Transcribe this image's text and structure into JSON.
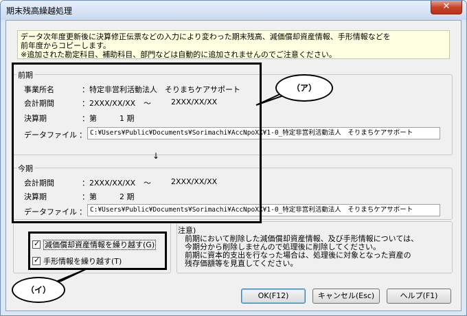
{
  "window": {
    "title": "期末残高繰越処理",
    "close_glyph": "✕"
  },
  "notice": {
    "line1": "データ次年度更新後に決算修正伝票などの入力により変わった期末残高、減価償却資産情報、手形情報などを",
    "line2": "前年度からコピーします。",
    "line3": "※追加された勘定科目、補助科目、部門などは自動的に追加されませんのでご注意ください。"
  },
  "previous": {
    "legend": "前期",
    "office_label": "事業所名",
    "office_value": "：特定非営利活動法人　そりまちケアサポート",
    "period_label": "会計期間",
    "period_from": "：2XXX/XX/XX",
    "period_sep": "～",
    "period_to": "2XXX/XX/XX",
    "term_label": "決算期",
    "term_value": "：第　　　1 期",
    "datafile_label": "データファイル",
    "datafile_colon": "：",
    "datafile_value": "C:¥Users¥Public¥Documents¥Sorimachi¥AccNpoXX¥1-0_特定非営利活動法人　そりまちケアサポート"
  },
  "arrow": "↓",
  "current": {
    "legend": "今期",
    "period_label": "会計期間",
    "period_from": "：2XXX/XX/XX",
    "period_sep": "～",
    "period_to": "2XXX/XX/XX",
    "term_label": "決算期",
    "term_value": "：第　　　2 期",
    "datafile_label": "データファイル",
    "datafile_colon": "：",
    "datafile_value": "C:¥Users¥Public¥Documents¥Sorimachi¥AccNpoXX¥1-0_特定非営利活動法人　そりまちケアサポート"
  },
  "options": {
    "depreciation_label": "減価償却資産情報を繰り越す(G)",
    "depreciation_checked": true,
    "notes_label": "手形情報を繰り越す(T)",
    "notes_checked": true
  },
  "caution": {
    "title": "注意)",
    "line1": "前期において削除した減価償却資産情報、及び手形情報については、",
    "line2": "今期分から削除しませんので処理後に削除してください。",
    "line3": "前期に資本的支出を行なった場合は、処理後に対象となった資産の",
    "line4": "残存価額等を見直してください。"
  },
  "callouts": {
    "a": "（ア）",
    "b": "（イ）"
  },
  "buttons": {
    "ok": "OK(F12)",
    "cancel": "キャンセル(Esc)",
    "help": "ヘルプ(F1)"
  }
}
